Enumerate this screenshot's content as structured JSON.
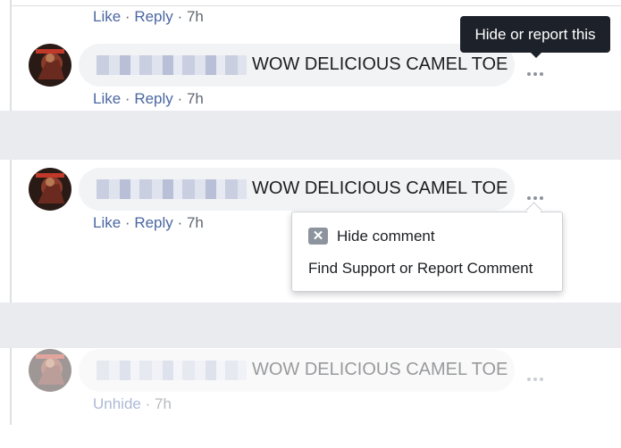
{
  "actions": {
    "like": "Like",
    "reply": "Reply",
    "time": "7h",
    "separator": "·",
    "unhide": "Unhide"
  },
  "comments": [
    {
      "text": "WOW DELICIOUS CAMEL TOE"
    },
    {
      "text": "WOW DELICIOUS CAMEL TOE"
    },
    {
      "text": "WOW DELICIOUS CAMEL TOE"
    }
  ],
  "tooltip": {
    "text": "Hide or report this"
  },
  "menu": {
    "hide": "Hide comment",
    "report": "Find Support or Report Comment"
  },
  "icons": {
    "more": "more-dots-icon",
    "hide": "close-x-icon"
  },
  "colors": {
    "link": "#4b67a1",
    "band": "#e9ebee",
    "tooltip_bg": "#1d2129"
  }
}
